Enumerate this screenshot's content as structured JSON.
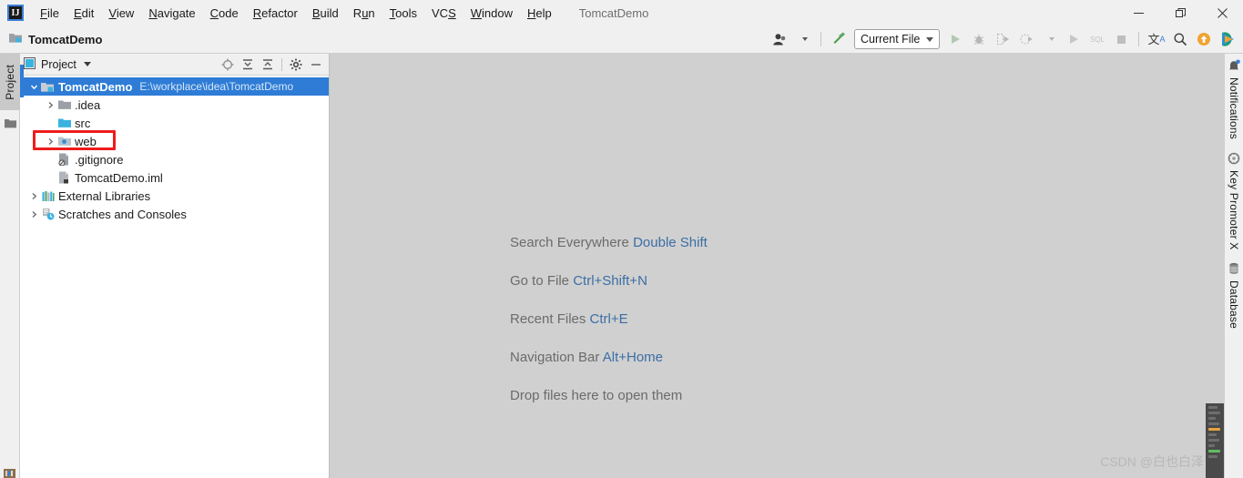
{
  "window": {
    "app_icon": "IJ",
    "project_title": "TomcatDemo",
    "minimize": "—",
    "restore": "❐",
    "close": "✕"
  },
  "menubar": [
    {
      "pre": "",
      "mn": "F",
      "post": "ile",
      "name": "menu-file"
    },
    {
      "pre": "",
      "mn": "E",
      "post": "dit",
      "name": "menu-edit"
    },
    {
      "pre": "",
      "mn": "V",
      "post": "iew",
      "name": "menu-view"
    },
    {
      "pre": "",
      "mn": "N",
      "post": "avigate",
      "name": "menu-navigate"
    },
    {
      "pre": "",
      "mn": "C",
      "post": "ode",
      "name": "menu-code"
    },
    {
      "pre": "",
      "mn": "R",
      "post": "efactor",
      "name": "menu-refactor"
    },
    {
      "pre": "",
      "mn": "B",
      "post": "uild",
      "name": "menu-build"
    },
    {
      "pre": "R",
      "mn": "u",
      "post": "n",
      "name": "menu-run"
    },
    {
      "pre": "",
      "mn": "T",
      "post": "ools",
      "name": "menu-tools"
    },
    {
      "pre": "VC",
      "mn": "S",
      "post": "",
      "name": "menu-vcs"
    },
    {
      "pre": "",
      "mn": "W",
      "post": "indow",
      "name": "menu-window"
    },
    {
      "pre": "",
      "mn": "H",
      "post": "elp",
      "name": "menu-help"
    }
  ],
  "navbar": {
    "crumb": "TomcatDemo"
  },
  "toolbar": {
    "run_config": "Current File",
    "items": [
      {
        "name": "user-avatar-icon",
        "glyph": "👤"
      },
      {
        "name": "hammer-build-icon",
        "glyph": "⚒"
      },
      {
        "name": "run-icon",
        "glyph": "▶"
      },
      {
        "name": "debug-icon",
        "glyph": "🐞"
      },
      {
        "name": "run-with-coverage-icon",
        "glyph": "⭮"
      },
      {
        "name": "profile-icon",
        "glyph": "◔"
      },
      {
        "name": "run-anything-icon",
        "glyph": "▶"
      },
      {
        "name": "sql-icon",
        "glyph": "SQL"
      },
      {
        "name": "stop-icon",
        "glyph": "■"
      },
      {
        "name": "translate-icon",
        "glyph": "文A"
      },
      {
        "name": "search-icon",
        "glyph": "🔍"
      },
      {
        "name": "update-icon",
        "glyph": "↑"
      },
      {
        "name": "play-colored-icon",
        "glyph": "▶"
      }
    ]
  },
  "left_strip": {
    "tab_label": "Project",
    "folder_icon": "folder-icon"
  },
  "right_strip": [
    {
      "label": "Notifications",
      "icon": "bell-icon",
      "name": "rightstrip-notifications"
    },
    {
      "label": "Key Promoter X",
      "icon": "key-promoter-icon",
      "name": "rightstrip-key-promoter"
    },
    {
      "label": "Database",
      "icon": "database-icon",
      "name": "rightstrip-database"
    }
  ],
  "project_panel": {
    "title": "Project",
    "header_icons": [
      {
        "name": "select-opened-file-icon",
        "glyph": "⊕"
      },
      {
        "name": "expand-all-icon",
        "glyph": "⤓"
      },
      {
        "name": "collapse-all-icon",
        "glyph": "⤒"
      },
      {
        "name": "settings-gear-icon",
        "glyph": "⚙"
      },
      {
        "name": "hide-panel-icon",
        "glyph": "—"
      }
    ],
    "tree": [
      {
        "label": "TomcatDemo",
        "path": "E:\\workplace\\idea\\TomcatDemo",
        "indent": 0,
        "arrow": "open",
        "icon": "module-icon",
        "selected": true,
        "name": "tree-node-tomcatdemo"
      },
      {
        "label": ".idea",
        "path": "",
        "indent": 1,
        "arrow": "closed",
        "icon": "folder-gray",
        "selected": false,
        "name": "tree-node-idea"
      },
      {
        "label": "src",
        "path": "",
        "indent": 1,
        "arrow": "none",
        "icon": "folder-cyan",
        "selected": false,
        "name": "tree-node-src"
      },
      {
        "label": "web",
        "path": "",
        "indent": 1,
        "arrow": "closed",
        "icon": "folder-web",
        "selected": false,
        "name": "tree-node-web",
        "highlighted": true
      },
      {
        "label": ".gitignore",
        "path": "",
        "indent": 1,
        "arrow": "none",
        "icon": "file-gitignore",
        "selected": false,
        "name": "tree-node-gitignore"
      },
      {
        "label": "TomcatDemo.iml",
        "path": "",
        "indent": 1,
        "arrow": "none",
        "icon": "file-iml",
        "selected": false,
        "name": "tree-node-iml"
      },
      {
        "label": "External Libraries",
        "path": "",
        "indent": 0,
        "arrow": "closed",
        "icon": "libraries-icon",
        "selected": false,
        "name": "tree-node-external-libraries"
      },
      {
        "label": "Scratches and Consoles",
        "path": "",
        "indent": 0,
        "arrow": "closed",
        "icon": "scratches-icon",
        "selected": false,
        "name": "tree-node-scratches"
      }
    ]
  },
  "editor": {
    "hints": [
      {
        "text": "Search Everywhere",
        "key": "Double Shift",
        "name": "hint-search-everywhere"
      },
      {
        "text": "Go to File",
        "key": "Ctrl+Shift+N",
        "name": "hint-go-to-file"
      },
      {
        "text": "Recent Files",
        "key": "Ctrl+E",
        "name": "hint-recent-files"
      },
      {
        "text": "Navigation Bar",
        "key": "Alt+Home",
        "name": "hint-navigation-bar"
      },
      {
        "text": "Drop files here to open them",
        "key": "",
        "name": "hint-drop-files"
      }
    ],
    "watermark": "CSDN @白也白泽"
  }
}
